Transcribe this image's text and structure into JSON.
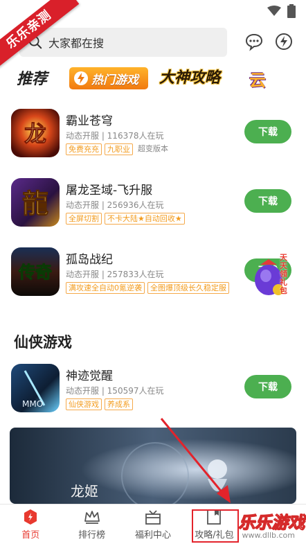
{
  "ribbon": {
    "text": "乐乐亲测"
  },
  "search": {
    "placeholder": "大家都在搜"
  },
  "icons": {
    "search": "search-icon",
    "message": "chat-bubble-icon",
    "lightning": "lightning-icon",
    "wifi": "wifi-icon",
    "battery": "battery-icon"
  },
  "categories": [
    {
      "label": "推荐"
    },
    {
      "label": "热门游戏"
    },
    {
      "label": "大神攻略"
    },
    {
      "label": "云"
    }
  ],
  "games": [
    {
      "name": "霸业苍穹",
      "meta": "动态开服 | 116378人在玩",
      "tags": [
        "免费充充",
        "九职业"
      ],
      "plain_tags": [
        "超变版本"
      ],
      "button": "下载"
    },
    {
      "name": "屠龙圣域-飞升服",
      "meta": "动态开服 | 256936人在玩",
      "tags": [
        "全屏切割",
        "不卡大陆★自动回收★"
      ],
      "plain_tags": [],
      "button": "下载"
    },
    {
      "name": "孤岛战纪",
      "meta": "动态开服 | 257833人在玩",
      "tags": [
        "满攻速全自动0氪逆袭",
        "全图爆顶级长久稳定服"
      ],
      "plain_tags": [],
      "button": "下载"
    }
  ],
  "floating_ad": {
    "text": "天天领礼包"
  },
  "section": {
    "title": "仙侠游戏"
  },
  "xianxia_games": [
    {
      "name": "神迹觉醒",
      "meta": "动态开服 | 150597人在玩",
      "tags": [
        "仙侠游戏",
        "养成系"
      ],
      "button": "下载"
    }
  ],
  "banner": {
    "caption": "龙姬"
  },
  "icon_texts": {
    "game1": "龙",
    "game2": "龍",
    "game3": "传奇",
    "game4": "MMO"
  },
  "tabbar": [
    {
      "label": "首页",
      "icon": "home-icon",
      "active": true
    },
    {
      "label": "排行榜",
      "icon": "crown-icon",
      "active": false
    },
    {
      "label": "福利中心",
      "icon": "gift-icon",
      "active": false
    },
    {
      "label": "攻略/礼包",
      "icon": "book-icon",
      "active": false
    }
  ],
  "watermark": {
    "text": "乐乐游戏",
    "url": "www.dllb.com"
  },
  "colors": {
    "accent": "#e8392f",
    "download": "#4caf50",
    "tag": "#f39c1f"
  }
}
